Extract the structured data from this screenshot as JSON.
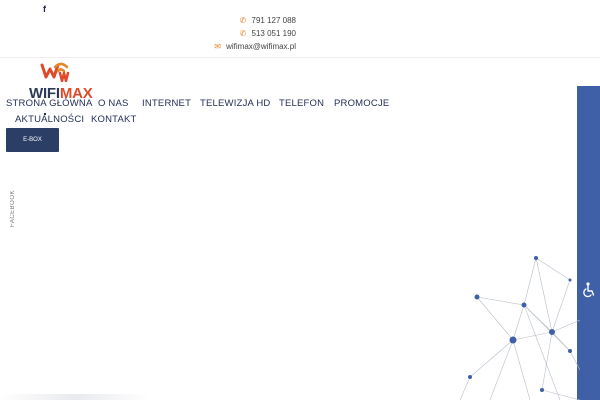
{
  "social": {
    "facebook_icon": "f",
    "facebook_vertical": "FACEBOOK"
  },
  "contacts": [
    {
      "icon": "phone-icon",
      "text": "791 127 088"
    },
    {
      "icon": "phone-icon",
      "text": "513 051 190"
    },
    {
      "icon": "envelope-icon",
      "text": "wifimax@wifimax.pl"
    }
  ],
  "logo": {
    "word_part1": "WIFI",
    "word_part2": "MAX"
  },
  "nav": {
    "items": [
      {
        "label": "STRONA GŁÓWNA"
      },
      {
        "label": "O NAS"
      },
      {
        "label": "INTERNET"
      },
      {
        "label": "TELEWIZJA HD"
      },
      {
        "label": "TELEFON"
      },
      {
        "label": "PROMOCJE"
      },
      {
        "label": "AKTUALNOŚCI"
      },
      {
        "label": "KONTAKT"
      }
    ]
  },
  "ebox": {
    "label": "E-BOX"
  },
  "colors": {
    "accent": "#e8862a",
    "brand_dark": "#2b3a55",
    "brand_red": "#e04a2a",
    "side_tab": "#3f5fa7"
  }
}
